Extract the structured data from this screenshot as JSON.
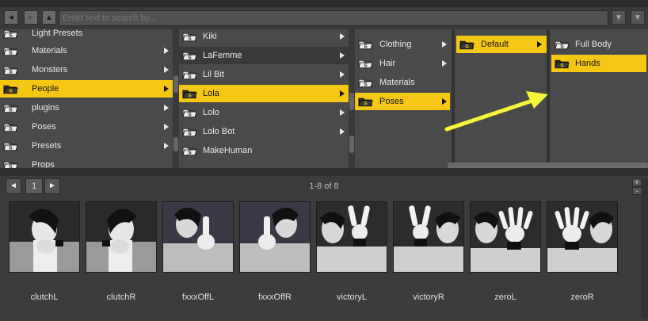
{
  "toolbar": {
    "back_icon": "back-arrow-icon",
    "forward_icon": "forward-arrow-icon",
    "up_icon": "up-arrow-icon",
    "search_placeholder": "Enter text to search by...",
    "dropdown_icon": "dropdown-arrow-icon",
    "clear_icon": "clear-icon"
  },
  "columns": [
    {
      "items": [
        {
          "label": "Light Presets",
          "selected": false
        },
        {
          "label": "Materials",
          "selected": false
        },
        {
          "label": "Monsters",
          "selected": false
        },
        {
          "label": "People",
          "selected": true
        },
        {
          "label": "plugins",
          "selected": false
        },
        {
          "label": "Poses",
          "selected": false
        },
        {
          "label": "Presets",
          "selected": false
        },
        {
          "label": "Props",
          "selected": false
        }
      ]
    },
    {
      "items": [
        {
          "label": "Kiki",
          "selected": false
        },
        {
          "label": "LaFemme",
          "selected": false,
          "hover": true
        },
        {
          "label": "Lil Bit",
          "selected": false
        },
        {
          "label": "Lola",
          "selected": true
        },
        {
          "label": "Lolo",
          "selected": false
        },
        {
          "label": "Lolo Bot",
          "selected": false
        },
        {
          "label": "MakeHuman",
          "selected": false
        }
      ]
    },
    {
      "items": [
        {
          "label": "Clothing",
          "selected": false
        },
        {
          "label": "Hair",
          "selected": false
        },
        {
          "label": "Materials",
          "selected": false
        },
        {
          "label": "Poses",
          "selected": true
        }
      ]
    },
    {
      "items": [
        {
          "label": "Default",
          "selected": true
        }
      ]
    },
    {
      "items": [
        {
          "label": "Full Body",
          "selected": false
        },
        {
          "label": "Hands",
          "selected": true
        }
      ]
    }
  ],
  "colors": {
    "selection": "#f5c715",
    "annotation_arrow": "#f5f53a",
    "folder": "#d9d9d9"
  },
  "pager": {
    "prev_icon": "prev-page-icon",
    "page": "1",
    "next_icon": "next-page-icon",
    "count": "1-8 of 8",
    "zoom_in": "+",
    "zoom_out": "-"
  },
  "thumbnails": [
    {
      "label": "clutchL"
    },
    {
      "label": "clutchR"
    },
    {
      "label": "fxxxOffL"
    },
    {
      "label": "fxxxOffR"
    },
    {
      "label": "victoryL"
    },
    {
      "label": "victoryR"
    },
    {
      "label": "zeroL"
    },
    {
      "label": "zeroR"
    }
  ]
}
